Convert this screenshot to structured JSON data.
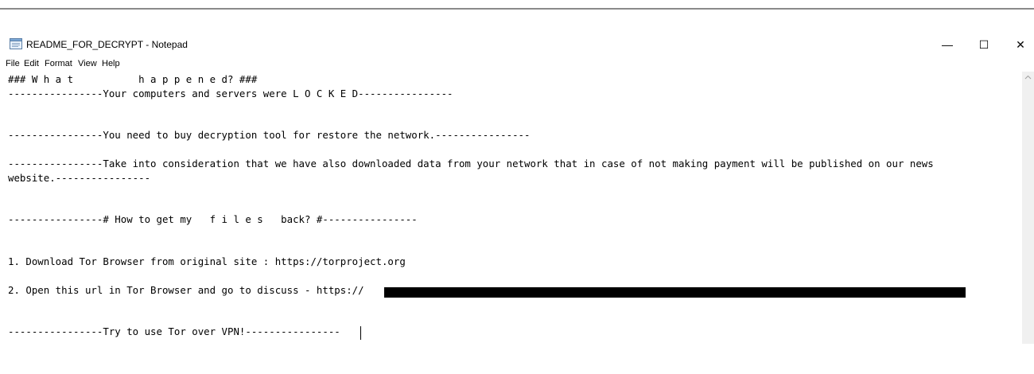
{
  "window": {
    "title": "README_FOR_DECRYPT - Notepad",
    "minimize_glyph": "—",
    "maximize_glyph": "☐",
    "close_glyph": "✕"
  },
  "menu": {
    "items": [
      {
        "label": "File"
      },
      {
        "label": "Edit"
      },
      {
        "label": "Format"
      },
      {
        "label": "View"
      },
      {
        "label": "Help"
      }
    ]
  },
  "document": {
    "lines": [
      "### W h a t           h a p p e n e d? ###",
      "----------------Your computers and servers were L O C K E D----------------",
      "----------------You need to buy decryption tool for restore the network.----------------",
      "----------------Take into consideration that we have also downloaded data from your network that in case of not making payment will be published on our news",
      "website.----------------",
      "----------------# How to get my   f i l e s   back? #----------------",
      "1. Download Tor Browser from original site : https://torproject.org",
      "2. Open this url in Tor Browser and go to discuss - https://",
      "----------------Try to use Tor over VPN!----------------"
    ],
    "redacted": true
  },
  "icons": {
    "app": "notepad-icon",
    "scroll_up": "scroll-up-arrow-icon"
  }
}
